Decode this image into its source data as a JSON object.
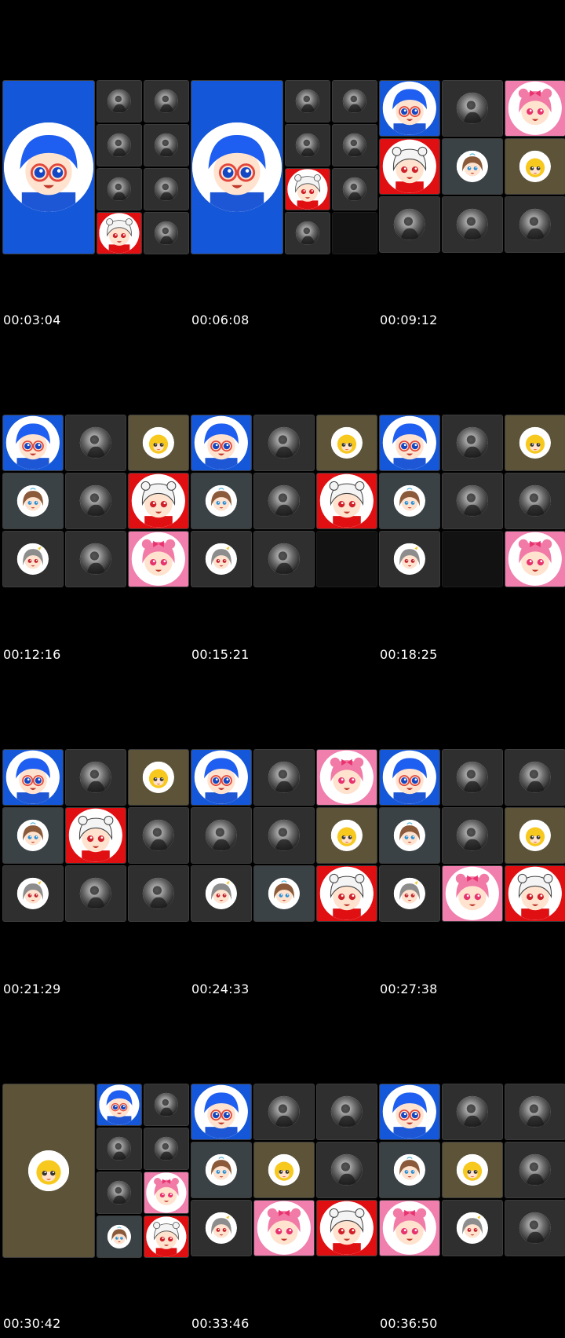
{
  "timestamps": [
    "00:03:04",
    "00:06:08",
    "00:09:12",
    "00:12:16",
    "00:15:21",
    "00:18:25",
    "00:21:29",
    "00:24:33",
    "00:27:38",
    "00:30:42",
    "00:33:46",
    "00:36:50"
  ],
  "colors": {
    "background": "#000000",
    "tile_gray": "#2f2f2f",
    "tile_olive": "#5c5338",
    "avatar_blue": "#1457d9",
    "avatar_red": "#e00f12",
    "avatar_pink": "#f07fae",
    "avatar_skyblue": "#7fd2f2"
  },
  "icons": {
    "blue_boy": "blue-hair-boy-avatar-icon",
    "white_girl": "white-hair-girl-red-avatar-icon",
    "pink_girl": "pink-hair-girl-avatar-icon",
    "brown_girl": "brown-hair-girl-avatar-icon",
    "duck": "yellow-duck-avatar-icon",
    "gray_girl": "gray-hair-girl-avatar-icon",
    "photo": "photo-profile-avatar-icon"
  }
}
